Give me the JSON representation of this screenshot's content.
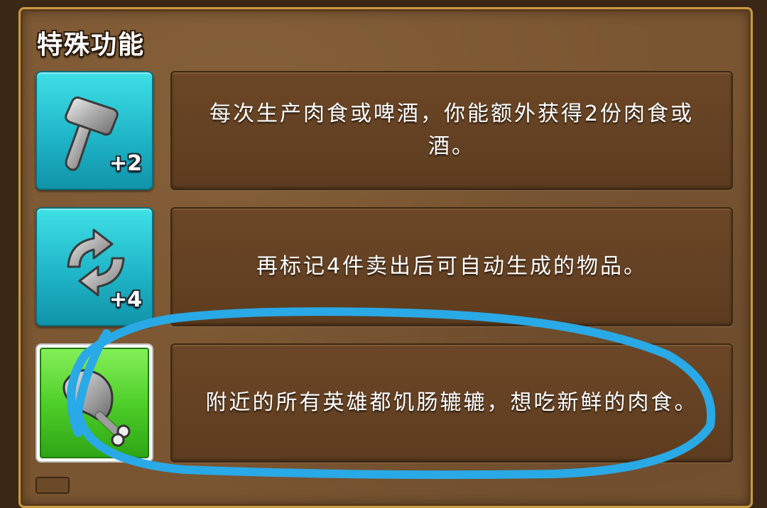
{
  "panel": {
    "title": "特殊功能"
  },
  "abilities": [
    {
      "icon": "hammer-icon",
      "bonus": "+2",
      "description": "每次生产肉食或啤酒，你能额外获得2份肉食或酒。"
    },
    {
      "icon": "refresh-icon",
      "bonus": "+4",
      "description": "再标记4件卖出后可自动生成的物品。"
    },
    {
      "icon": "meat-drumstick-icon",
      "bonus": "",
      "description": "附近的所有英雄都饥肠辘辘，想吃新鲜的肉食。"
    }
  ],
  "colors": {
    "blue_tile": "#1fb6c8",
    "green_tile": "#4fcf2a",
    "annotation_circle": "#29a9e6",
    "panel_wood": "#7a5531"
  }
}
